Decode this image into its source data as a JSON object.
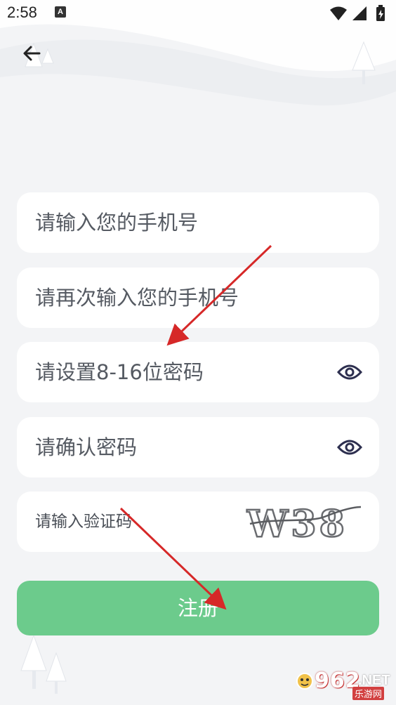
{
  "status_bar": {
    "time": "2:58",
    "notification_icon_letter": "A",
    "icons": [
      "wifi-icon",
      "signal-icon",
      "battery-icon"
    ]
  },
  "header": {
    "back_icon": "arrow-left-icon"
  },
  "form": {
    "phone_placeholder": "请输入您的手机号",
    "phone_confirm_placeholder": "请再次输入您的手机号",
    "password_placeholder": "请设置8-16位密码",
    "password_confirm_placeholder": "请确认密码",
    "captcha_placeholder": "请输入验证码",
    "captcha_text": "W38",
    "eye_icon": "eye-icon"
  },
  "register_button_label": "注册",
  "watermark": {
    "number": "962",
    "domain": ".NET",
    "subtitle": "乐游网"
  },
  "colors": {
    "background": "#f3f4f6",
    "field": "#ffffff",
    "placeholder": "#555a62",
    "primary_button": "#6ccb8c",
    "eye_icon": "#2d2f4f",
    "annotation_arrow": "#d62828"
  }
}
